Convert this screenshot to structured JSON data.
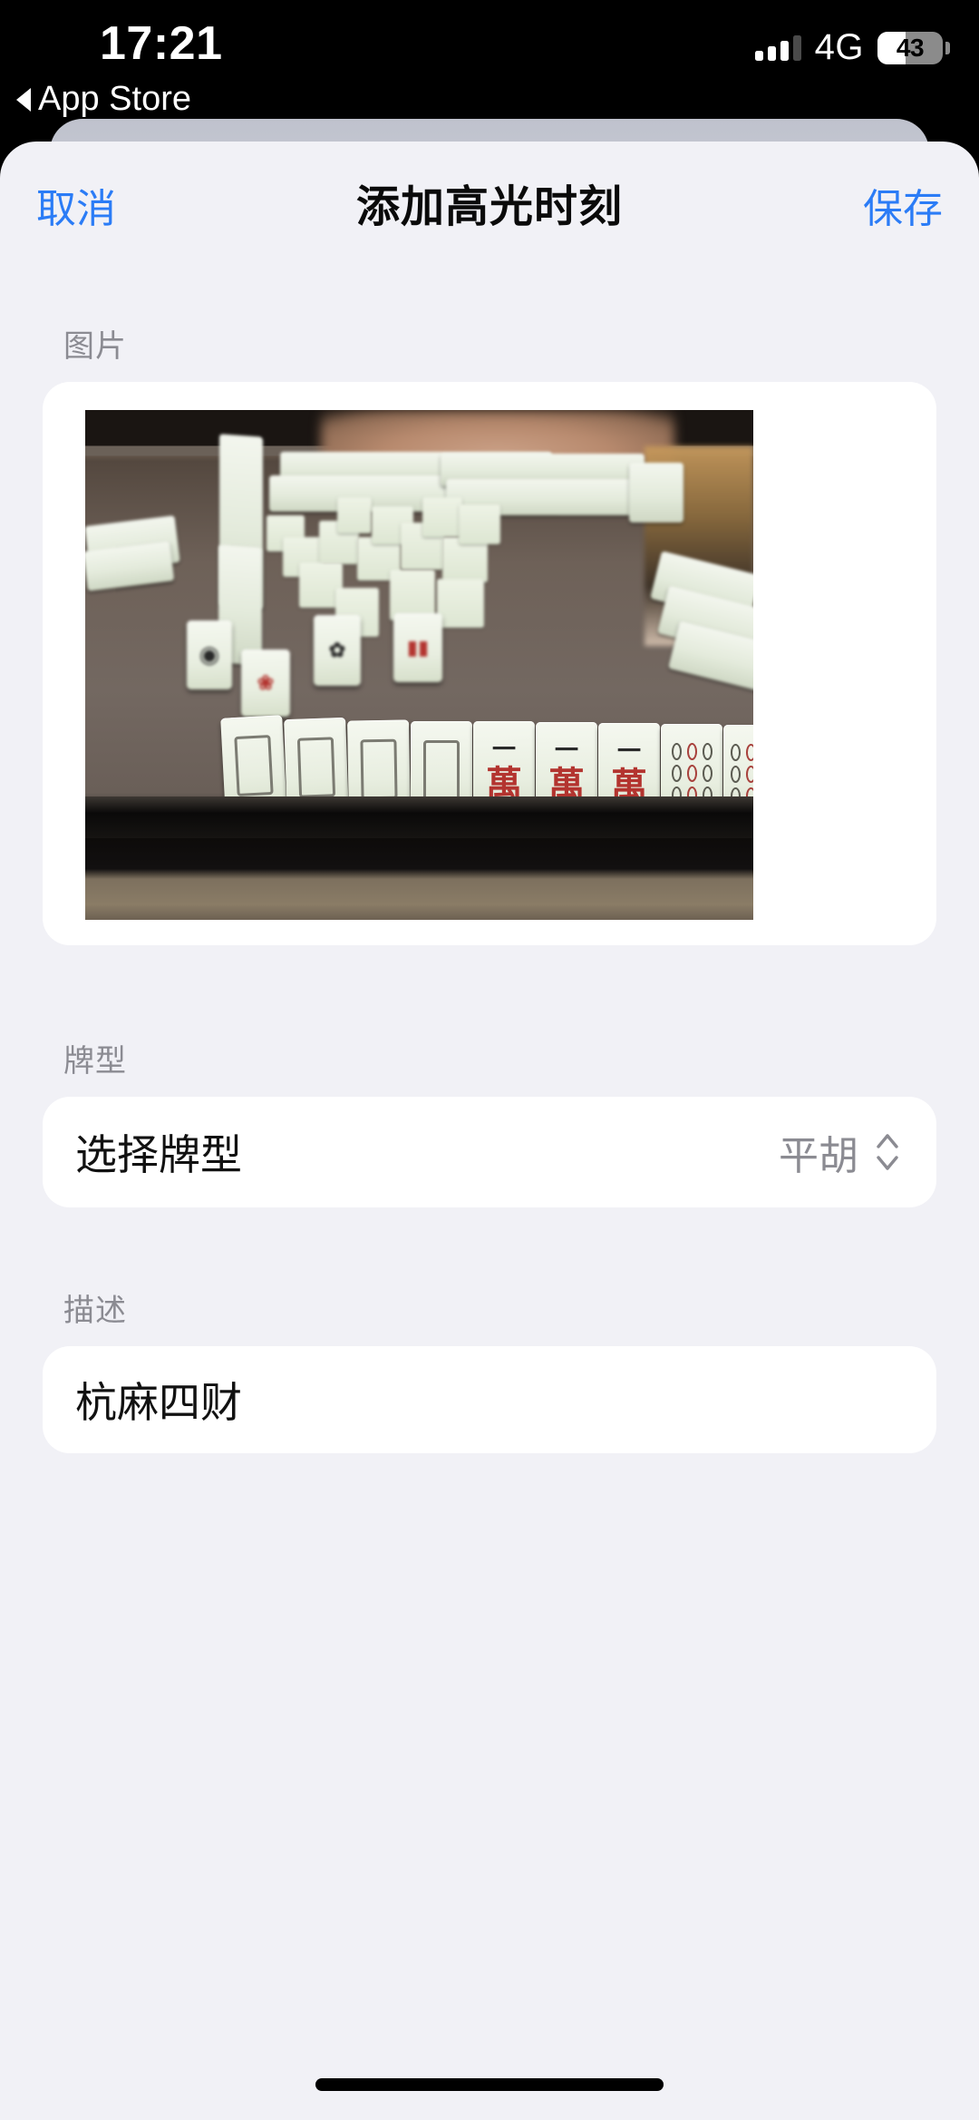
{
  "status_bar": {
    "time": "17:21",
    "network": "4G",
    "battery_level": "43",
    "back_link_label": "App Store",
    "signal_bars_filled": 3,
    "signal_bars_total": 4
  },
  "nav_bar": {
    "cancel_label": "取消",
    "title": "添加高光时刻",
    "save_label": "保存",
    "accent_color": "#2b7cf6"
  },
  "image_section": {
    "label": "图片",
    "photo_alt": "麻将桌面照片"
  },
  "type_section": {
    "label": "牌型",
    "placeholder": "选择牌型",
    "selected_value": "平胡"
  },
  "description_section": {
    "label": "描述",
    "value": "杭麻四财"
  },
  "colors": {
    "background": "#F1F1F6",
    "card": "#FFFFFF",
    "accent": "#2b7cf6",
    "secondary_text": "#8b8b92",
    "primary_text": "#111111"
  },
  "photo_scene": {
    "front_row_tiles": [
      "白板",
      "白板",
      "白板",
      "白板",
      "一萬",
      "一萬",
      "一萬",
      "九筒",
      "九筒"
    ],
    "table_color": "#6e6158"
  }
}
